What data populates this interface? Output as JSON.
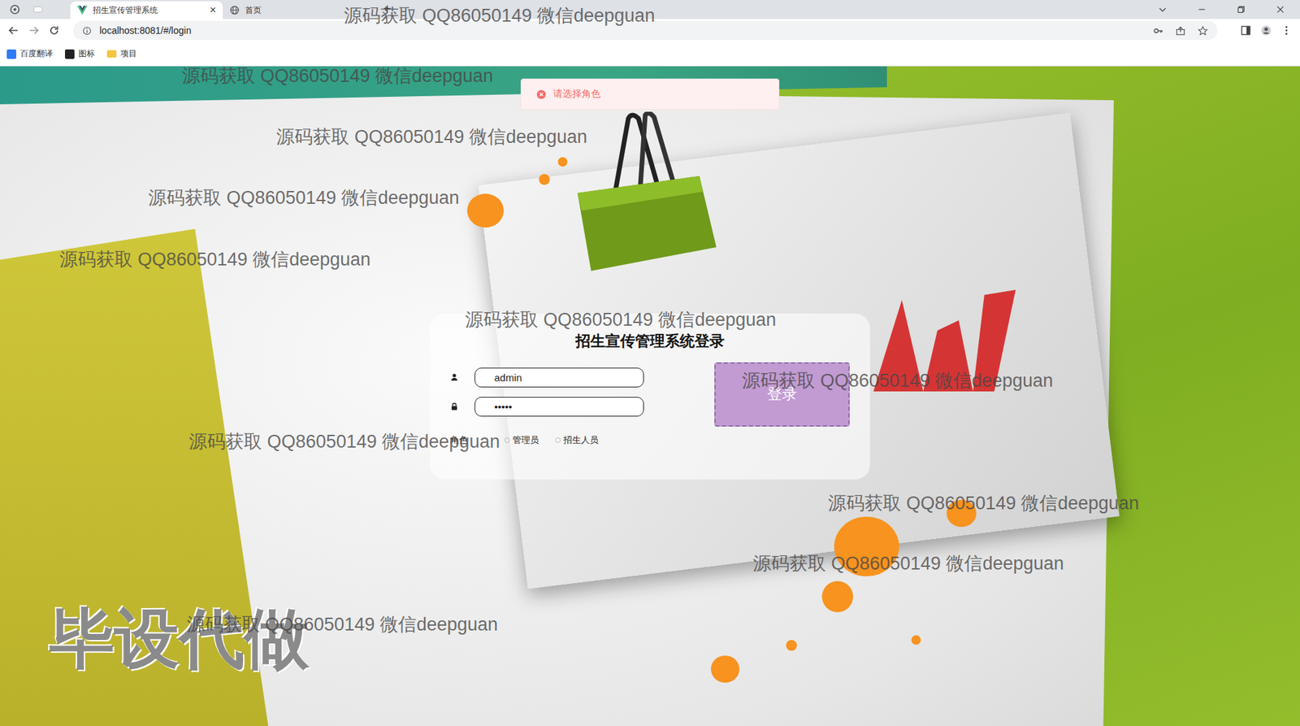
{
  "browser": {
    "tabs": [
      {
        "label": "招生宣传管理系统",
        "selected": true,
        "kind": "vue",
        "close": "×"
      },
      {
        "label": "首页",
        "selected": false,
        "kind": "globe",
        "close": ""
      }
    ],
    "new_tab": "+",
    "url": "localhost:8081/#/login",
    "bookmarks": [
      {
        "label": "百度翻译",
        "kind": "translate"
      },
      {
        "label": "图标",
        "kind": "image"
      },
      {
        "label": "项目",
        "kind": "folder"
      }
    ]
  },
  "toast": {
    "message": "请选择角色",
    "kind": "error"
  },
  "login": {
    "title": "招生宣传管理系统登录",
    "username": "admin",
    "password": "•••••",
    "role_label": "角色",
    "roles": [
      {
        "label": "管理员",
        "selected": false
      },
      {
        "label": "招生人员",
        "selected": false
      }
    ],
    "submit": "登录"
  },
  "watermarks": [
    "源码获取 QQ86050149 微信deepguan",
    "源码获取 QQ86050149 微信deepguan",
    "源码获取 QQ86050149 微信deepguan",
    "源码获取 QQ86050149 微信deepguan",
    "源码获取 QQ86050149 微信deepguan",
    "源码获取 QQ86050149 微信deepguan",
    "源码获取 QQ86050149 微信deepguan",
    "源码获取 QQ86050149 微信deepguan",
    "源码获取 QQ86050149 微信deepguan",
    "源码获取 QQ86050149 微信deepguan",
    "源码获取 QQ86050149 微信deepguan"
  ],
  "overlay_text": "毕设代做"
}
